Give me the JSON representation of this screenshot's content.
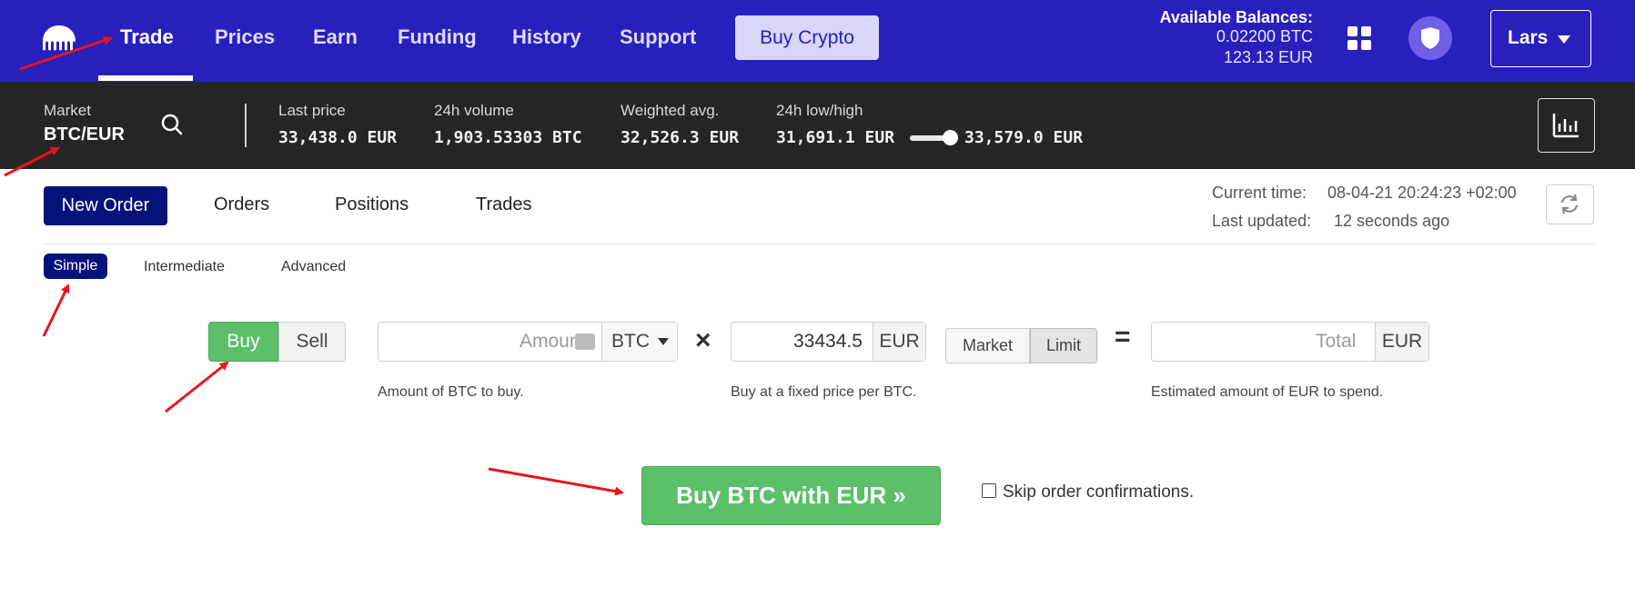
{
  "nav": {
    "items": [
      {
        "label": "Trade",
        "active": true
      },
      {
        "label": "Prices"
      },
      {
        "label": "Earn"
      },
      {
        "label": "Funding"
      },
      {
        "label": "History"
      },
      {
        "label": "Support"
      }
    ],
    "buy_crypto_label": "Buy Crypto",
    "balances": {
      "title": "Available Balances:",
      "btc": "0.02200 BTC",
      "eur": "123.13 EUR"
    },
    "user_label": "Lars",
    "icons": [
      "kraken-logo-icon",
      "apps-grid-icon",
      "shield-icon",
      "chevron-down-icon"
    ]
  },
  "market": {
    "label": "Market",
    "pair": "BTC/EUR",
    "stats": [
      {
        "label": "Last price",
        "value": "33,438.0 EUR"
      },
      {
        "label": "24h volume",
        "value": "1,903.53303 BTC"
      },
      {
        "label": "Weighted avg.",
        "value": "32,526.3 EUR"
      },
      {
        "label": "24h low/high",
        "low": "31,691.1 EUR",
        "high": "33,579.0 EUR"
      }
    ],
    "icons": [
      "search-icon",
      "chart-icon"
    ]
  },
  "orders": {
    "tabs": [
      "New Order",
      "Orders",
      "Positions",
      "Trades"
    ],
    "current_time_label": "Current time:",
    "current_time": "08-04-21 20:24:23 +02:00",
    "last_updated_label": "Last updated:",
    "last_updated": "12 seconds ago",
    "refresh_icon": "refresh-icon"
  },
  "modes": [
    "Simple",
    "Intermediate",
    "Advanced"
  ],
  "form": {
    "side_buy": "Buy",
    "side_sell": "Sell",
    "amount_placeholder": "Amount",
    "amount_currency": "BTC",
    "amount_help": "Amount of BTC to buy.",
    "times": "×",
    "price_value": "33434.5",
    "price_currency": "EUR",
    "price_help": "Buy at a fixed price per BTC.",
    "type_market": "Market",
    "type_limit": "Limit",
    "equals": "=",
    "total_placeholder": "Total",
    "total_currency": "EUR",
    "total_help": "Estimated amount of EUR to spend.",
    "submit_label": "Buy BTC with EUR »",
    "skip_label": "Skip order confirmations."
  },
  "colors": {
    "nav_bg": "#2820bd",
    "market_bg": "#252525",
    "active_tab": "#05127a",
    "buy_green": "#5cbf6a",
    "annotation_arrow": "#e8141c"
  }
}
